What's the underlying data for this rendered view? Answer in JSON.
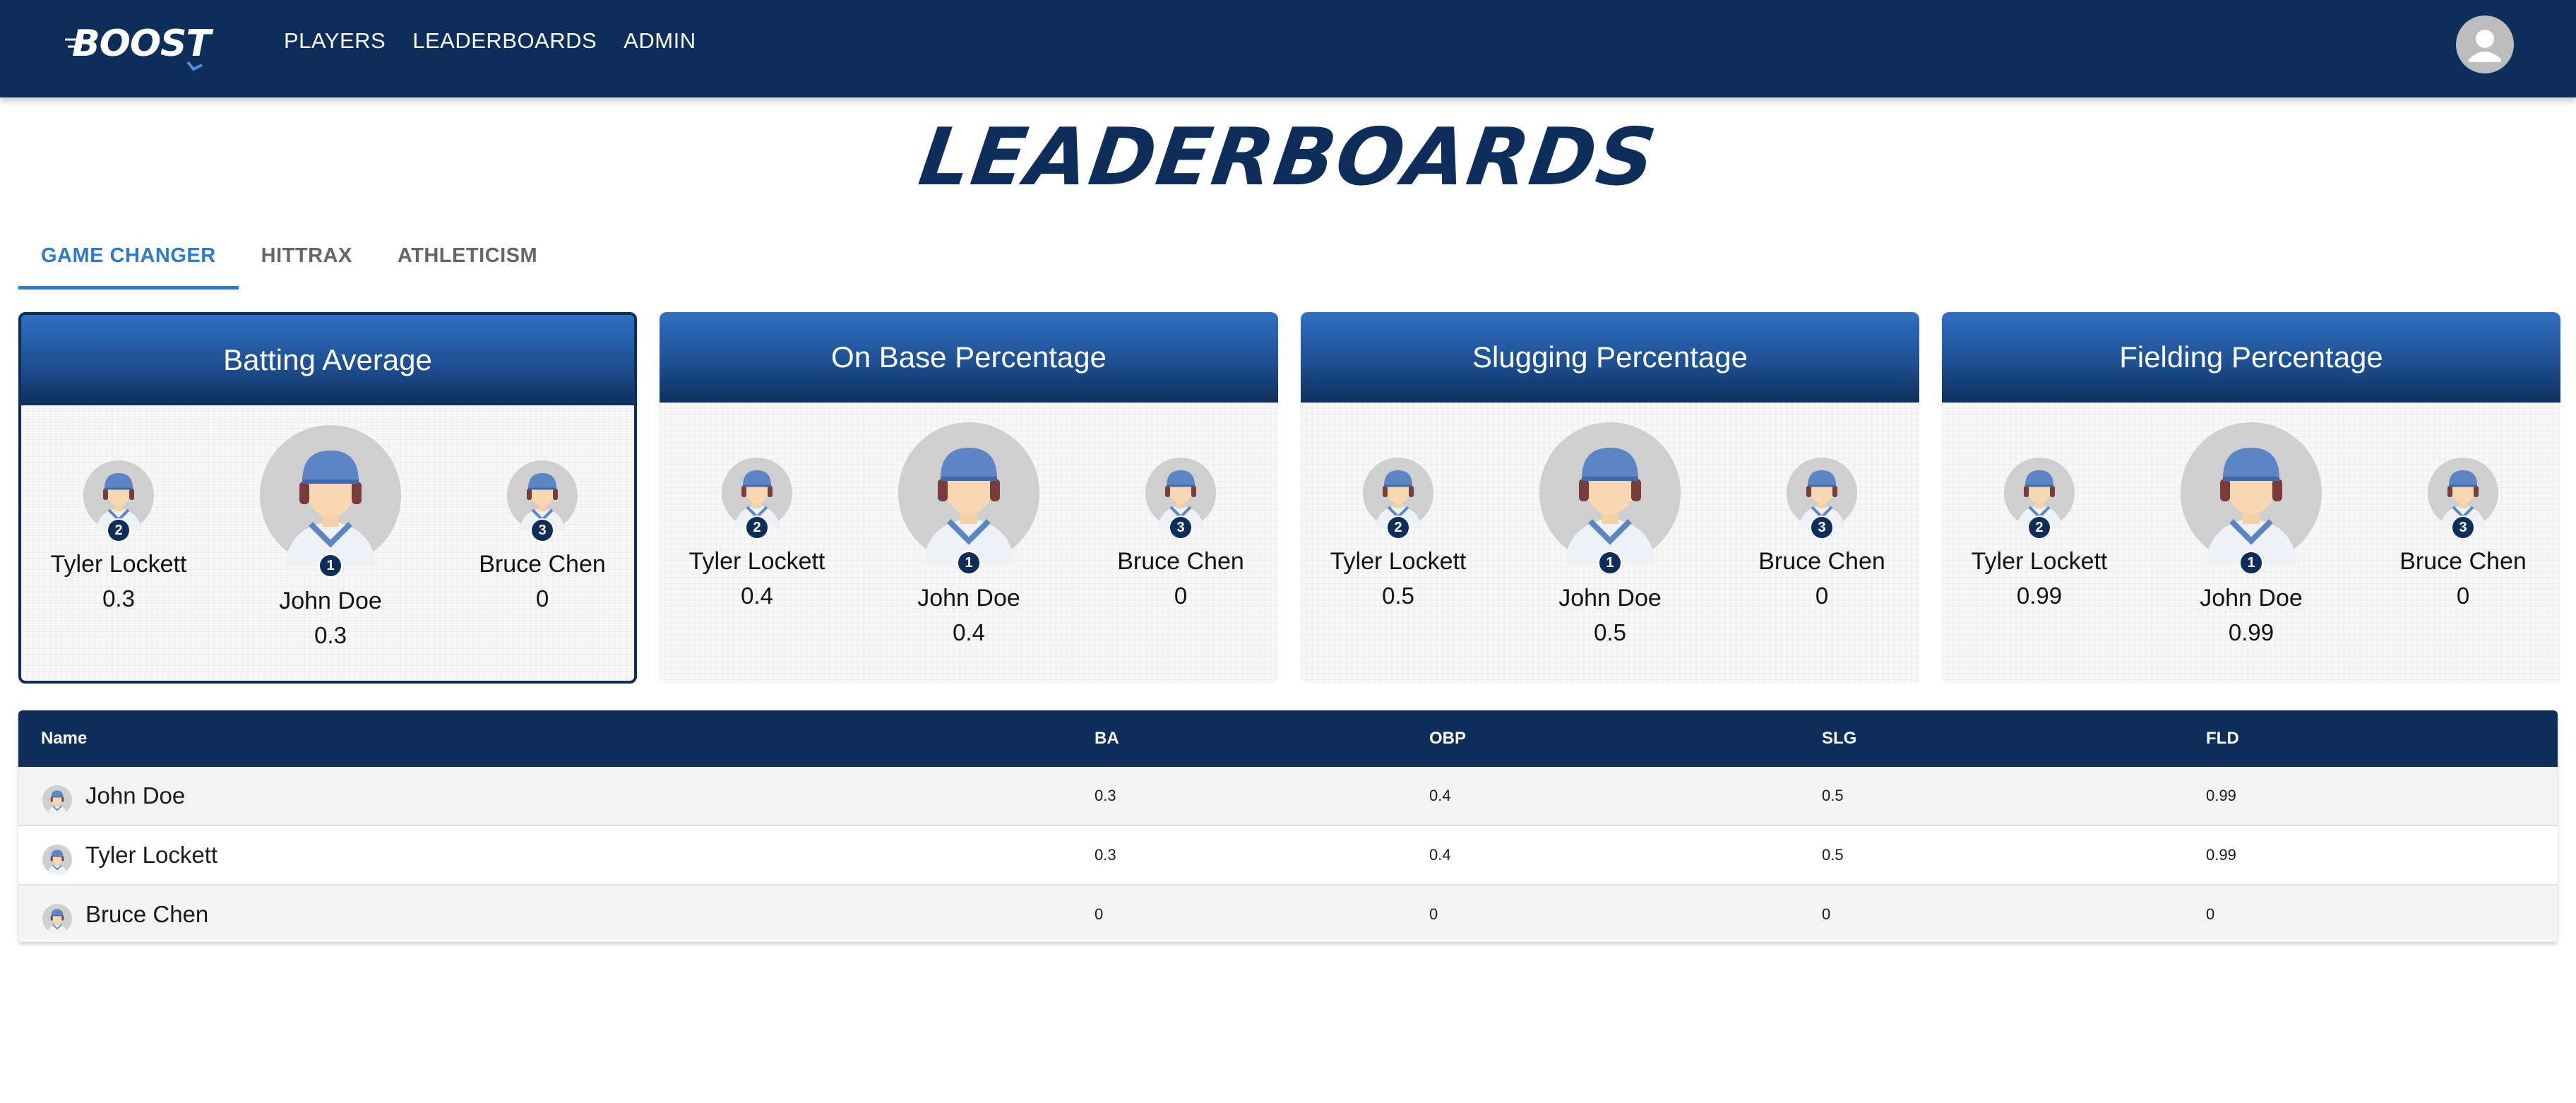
{
  "app": {
    "logo_text": "BOOST",
    "nav": [
      "PLAYERS",
      "LEADERBOARDS",
      "ADMIN"
    ]
  },
  "page": {
    "title": "LEADERBOARDS",
    "tabs": [
      "GAME CHANGER",
      "HITTRAX",
      "ATHLETICISM"
    ],
    "active_tab": "GAME CHANGER"
  },
  "cards": [
    {
      "title": "Batting Average",
      "selected": true,
      "first": {
        "name": "John Doe",
        "value": "0.3",
        "rank": "1"
      },
      "second": {
        "name": "Tyler Lockett",
        "value": "0.3",
        "rank": "2"
      },
      "third": {
        "name": "Bruce Chen",
        "value": "0",
        "rank": "3"
      }
    },
    {
      "title": "On Base Percentage",
      "selected": false,
      "first": {
        "name": "John Doe",
        "value": "0.4",
        "rank": "1"
      },
      "second": {
        "name": "Tyler Lockett",
        "value": "0.4",
        "rank": "2"
      },
      "third": {
        "name": "Bruce Chen",
        "value": "0",
        "rank": "3"
      }
    },
    {
      "title": "Slugging Percentage",
      "selected": false,
      "first": {
        "name": "John Doe",
        "value": "0.5",
        "rank": "1"
      },
      "second": {
        "name": "Tyler Lockett",
        "value": "0.5",
        "rank": "2"
      },
      "third": {
        "name": "Bruce Chen",
        "value": "0",
        "rank": "3"
      }
    },
    {
      "title": "Fielding Percentage",
      "selected": false,
      "first": {
        "name": "John Doe",
        "value": "0.99",
        "rank": "1"
      },
      "second": {
        "name": "Tyler Lockett",
        "value": "0.99",
        "rank": "2"
      },
      "third": {
        "name": "Bruce Chen",
        "value": "0",
        "rank": "3"
      }
    }
  ],
  "table": {
    "headers": [
      "Name",
      "BA",
      "OBP",
      "SLG",
      "FLD"
    ],
    "rows": [
      {
        "name": "John Doe",
        "ba": "0.3",
        "obp": "0.4",
        "slg": "0.5",
        "fld": "0.99"
      },
      {
        "name": "Tyler Lockett",
        "ba": "0.3",
        "obp": "0.4",
        "slg": "0.5",
        "fld": "0.99"
      },
      {
        "name": "Bruce Chen",
        "ba": "0",
        "obp": "0",
        "slg": "0",
        "fld": "0"
      }
    ]
  },
  "colors": {
    "navy": "#0d2d5a",
    "accent_blue": "#2f7ad1",
    "card_header": "#2f6fc2"
  },
  "icons": [
    "boost-logo-icon",
    "user-avatar-icon",
    "player-avatar-icon"
  ]
}
